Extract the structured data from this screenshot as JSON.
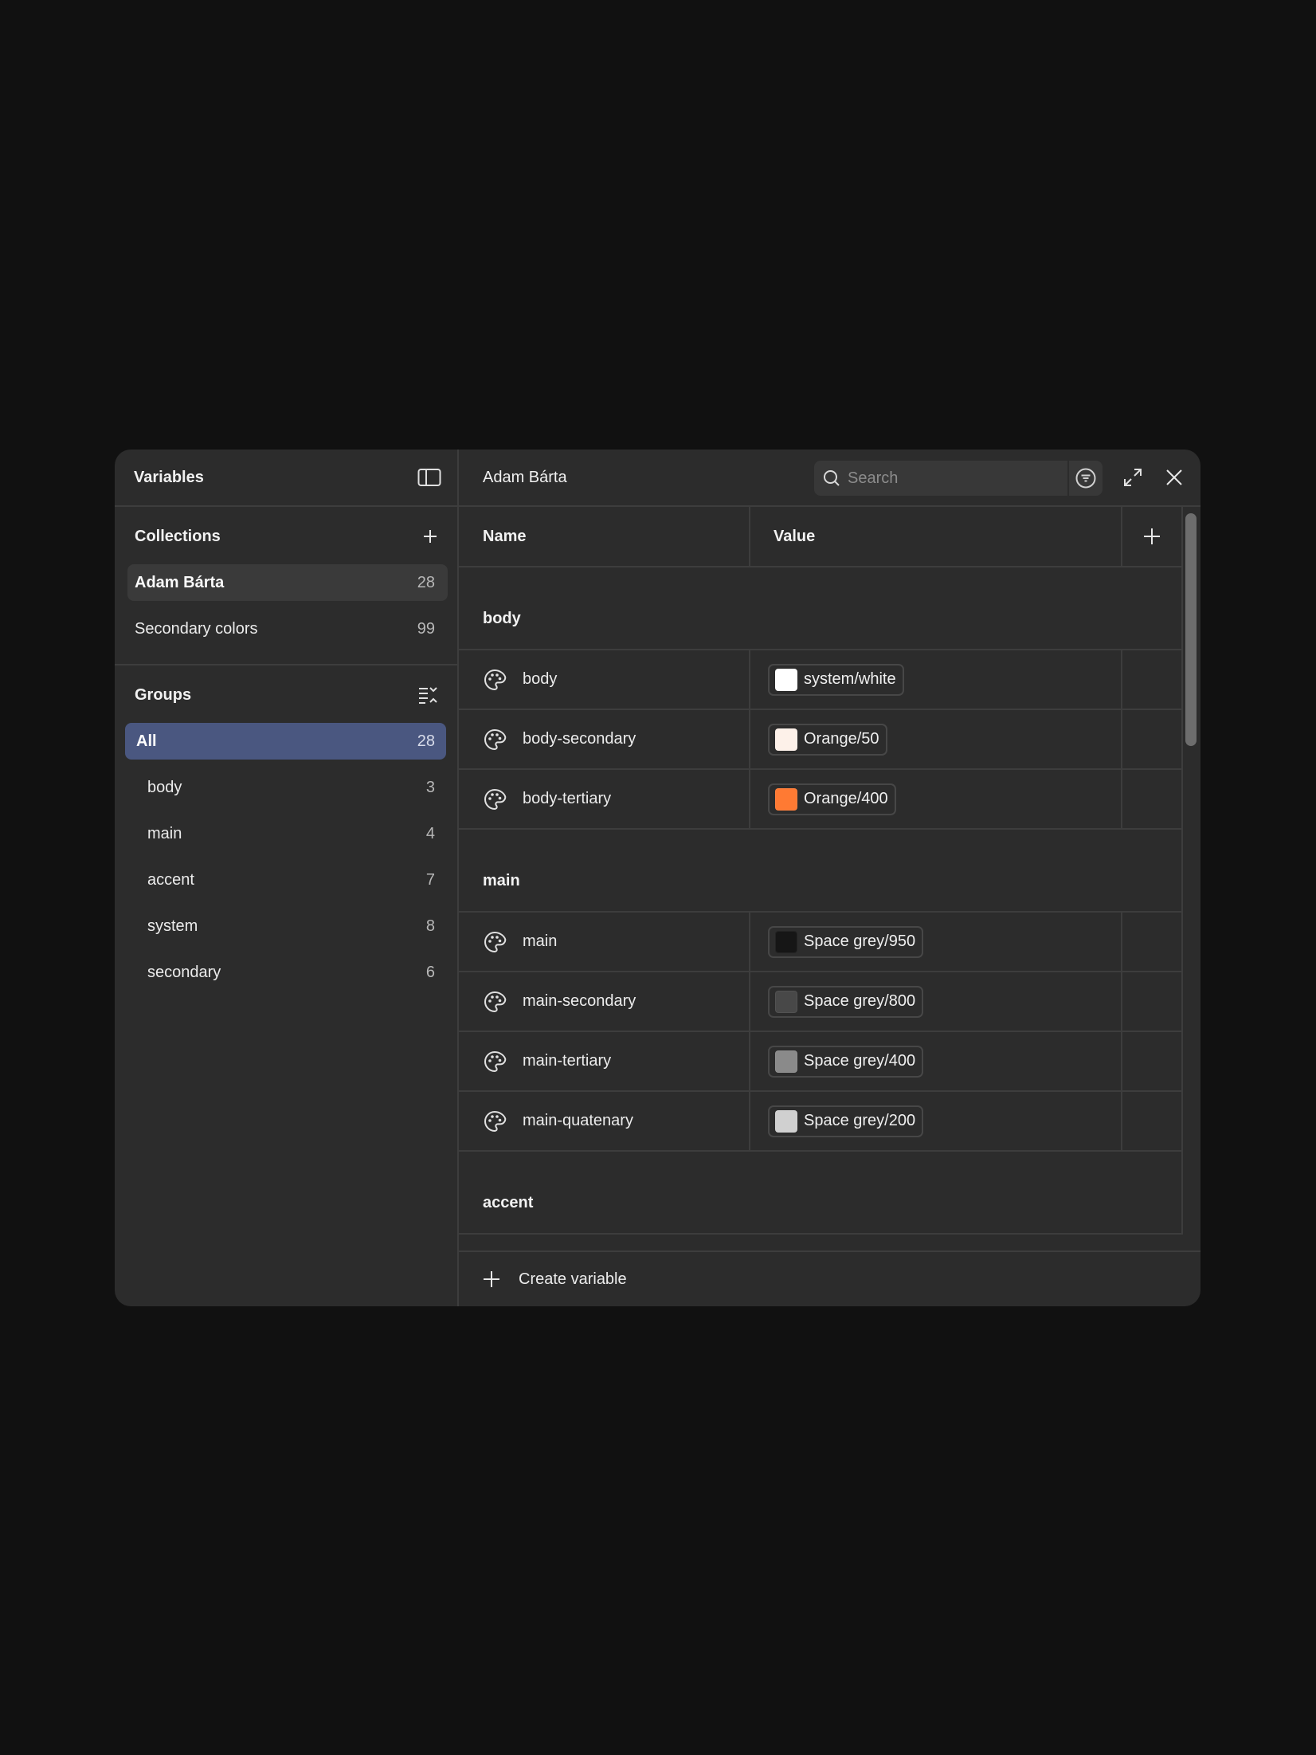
{
  "left": {
    "title": "Variables",
    "toggle_icon": "sidebar-toggle-icon",
    "collections_title": "Collections",
    "collections": [
      {
        "label": "Adam Bárta",
        "count": "28",
        "active": true
      },
      {
        "label": "Secondary colors",
        "count": "99",
        "active": false
      }
    ],
    "groups_title": "Groups",
    "groups": [
      {
        "label": "All",
        "count": "28",
        "active": true
      },
      {
        "label": "body",
        "count": "3"
      },
      {
        "label": "main",
        "count": "4"
      },
      {
        "label": "accent",
        "count": "7"
      },
      {
        "label": "system",
        "count": "8"
      },
      {
        "label": "secondary",
        "count": "6"
      }
    ]
  },
  "header": {
    "title": "Adam Bárta",
    "search_placeholder": "Search"
  },
  "table": {
    "col_name": "Name",
    "col_value": "Value",
    "groups": [
      {
        "name": "body",
        "rows": [
          {
            "name": "body",
            "value": "system/white",
            "color": "#ffffff"
          },
          {
            "name": "body-secondary",
            "value": "Orange/50",
            "color": "#fdf1e9"
          },
          {
            "name": "body-tertiary",
            "value": "Orange/400",
            "color": "#ff7a33"
          }
        ]
      },
      {
        "name": "main",
        "rows": [
          {
            "name": "main",
            "value": "Space grey/950",
            "color": "#161616"
          },
          {
            "name": "main-secondary",
            "value": "Space grey/800",
            "color": "#484848"
          },
          {
            "name": "main-tertiary",
            "value": "Space grey/400",
            "color": "#8a8a8a"
          },
          {
            "name": "main-quatenary",
            "value": "Space grey/200",
            "color": "#d0d0d0"
          }
        ]
      },
      {
        "name": "accent",
        "rows": []
      }
    ]
  },
  "footer": {
    "create_label": "Create variable"
  },
  "colors": {
    "background": "#111111",
    "panel": "#2c2c2c",
    "active_group": "#4a5780",
    "border": "#3d3d3d"
  }
}
